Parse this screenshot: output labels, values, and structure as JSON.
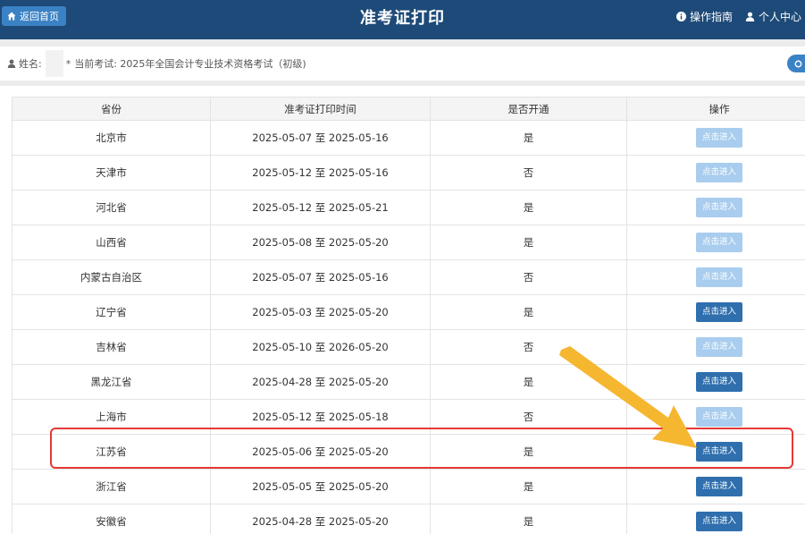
{
  "header": {
    "home_label": "返回首页",
    "title": "准考证打印",
    "guide_label": "操作指南",
    "user_center_label": "个人中心"
  },
  "info": {
    "name_label": "姓名:",
    "name_mark": "*",
    "exam_text": "当前考试: 2025年全国会计专业技术资格考试（初级)"
  },
  "table": {
    "headers": [
      "省份",
      "准考证打印时间",
      "是否开通",
      "操作"
    ],
    "button_label": "点击进入",
    "rows": [
      {
        "province": "北京市",
        "period": "2025-05-07 至 2025-05-16",
        "open": "是",
        "enabled": false
      },
      {
        "province": "天津市",
        "period": "2025-05-12 至 2025-05-16",
        "open": "否",
        "enabled": false
      },
      {
        "province": "河北省",
        "period": "2025-05-12 至 2025-05-21",
        "open": "是",
        "enabled": false
      },
      {
        "province": "山西省",
        "period": "2025-05-08 至 2025-05-20",
        "open": "是",
        "enabled": false
      },
      {
        "province": "内蒙古自治区",
        "period": "2025-05-07 至 2025-05-16",
        "open": "否",
        "enabled": false
      },
      {
        "province": "辽宁省",
        "period": "2025-05-03 至 2025-05-20",
        "open": "是",
        "enabled": true
      },
      {
        "province": "吉林省",
        "period": "2025-05-10 至 2026-05-20",
        "open": "否",
        "enabled": false
      },
      {
        "province": "黑龙江省",
        "period": "2025-04-28 至 2025-05-20",
        "open": "是",
        "enabled": true
      },
      {
        "province": "上海市",
        "period": "2025-05-12 至 2025-05-18",
        "open": "否",
        "enabled": false
      },
      {
        "province": "江苏省",
        "period": "2025-05-06 至 2025-05-20",
        "open": "是",
        "enabled": true
      },
      {
        "province": "浙江省",
        "period": "2025-05-05 至 2025-05-20",
        "open": "是",
        "enabled": true
      },
      {
        "province": "安徽省",
        "period": "2025-04-28 至 2025-05-20",
        "open": "是",
        "enabled": true
      }
    ]
  },
  "colors": {
    "header_bg": "#1d4a78",
    "button_enabled": "#2f6fae",
    "button_disabled": "#a9cdee",
    "highlight": "#e53935",
    "arrow": "#f5b630"
  }
}
